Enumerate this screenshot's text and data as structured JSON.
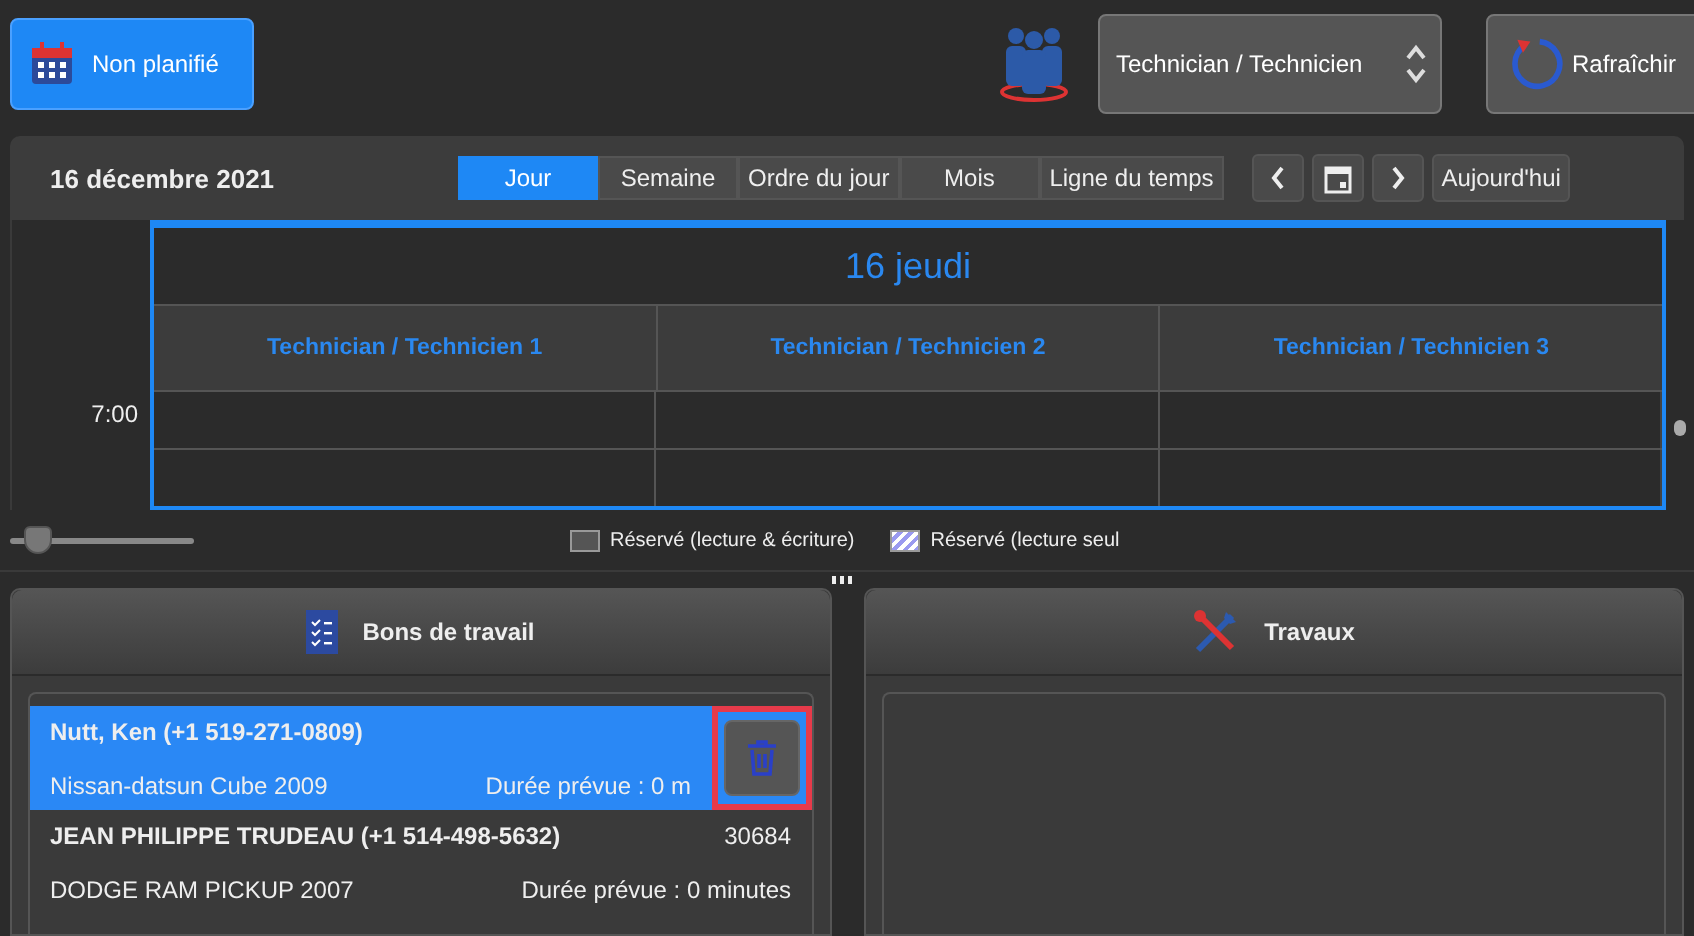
{
  "top_bar": {
    "unplanned_button": "Non planifié",
    "technician_select": {
      "value": "Technician / Technicien"
    },
    "refresh_button": "Rafraîchir"
  },
  "toolbar": {
    "date": "16 décembre 2021",
    "views": [
      {
        "label": "Jour",
        "selected": true
      },
      {
        "label": "Semaine",
        "selected": false
      },
      {
        "label": "Ordre du jour",
        "selected": false
      },
      {
        "label": "Mois",
        "selected": false
      },
      {
        "label": "Ligne du temps",
        "selected": false
      }
    ],
    "today_button": "Aujourd'hui"
  },
  "calendar": {
    "day_title": "16 jeudi",
    "technicians": [
      "Technician / Technicien 1",
      "Technician / Technicien 2",
      "Technician / Technicien 3"
    ],
    "time_label": "7:00"
  },
  "zoom_slider": {
    "level": 0.15
  },
  "legend": [
    {
      "kind": "solid",
      "label": "Réservé (lecture & écriture)"
    },
    {
      "kind": "hatched",
      "label": "Réservé (lecture seul"
    }
  ],
  "work_orders": {
    "title": "Bons de travail",
    "items": [
      {
        "name": "Nutt, Ken (+1 519-271-0809)",
        "vehicle": "Nissan-datsun Cube 2009",
        "duration": "Durée prévue : 0 m",
        "selected": true
      },
      {
        "name": "JEAN PHILIPPE TRUDEAU (+1 514-498-5632)",
        "number": "30684",
        "vehicle": "DODGE RAM PICKUP 2007",
        "duration": "Durée prévue : 0 minutes",
        "selected": false
      }
    ]
  },
  "jobs": {
    "title": "Travaux"
  }
}
